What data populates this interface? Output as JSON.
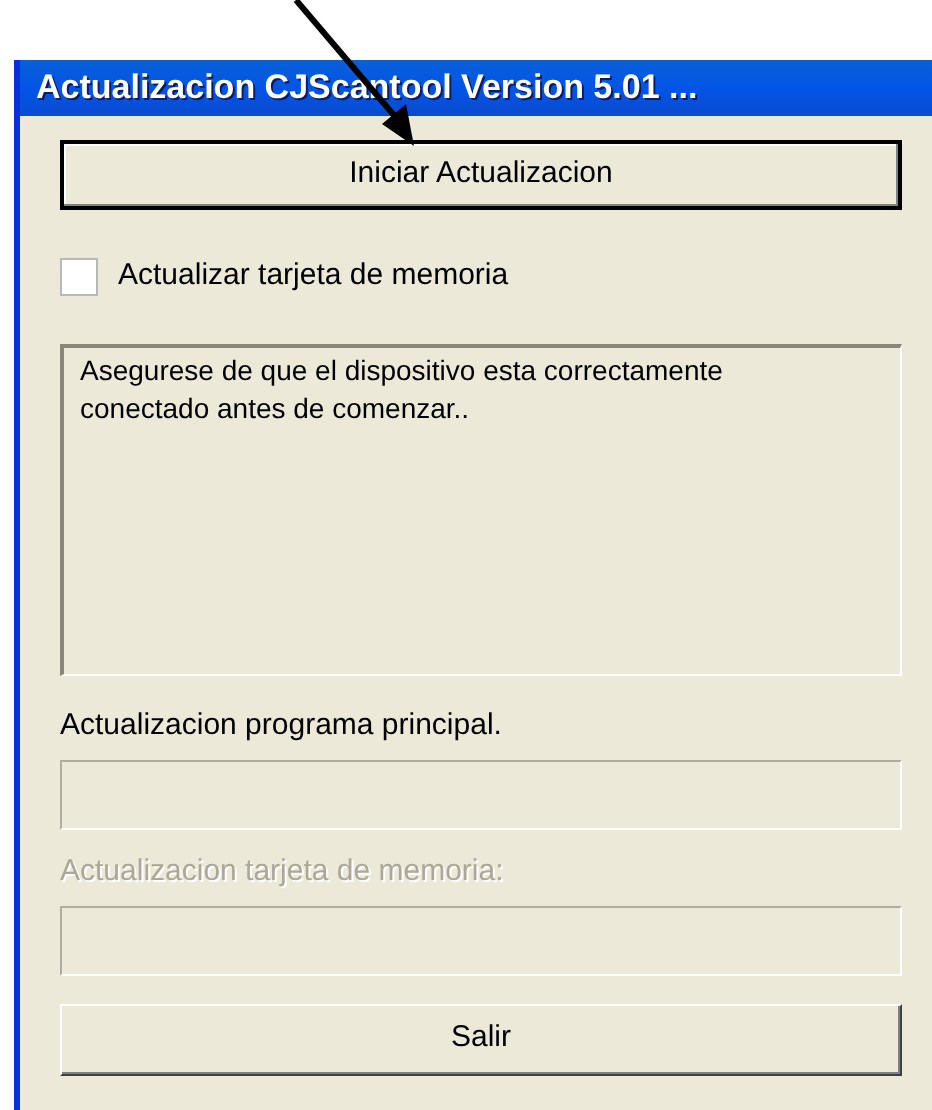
{
  "window": {
    "title": "Actualizacion CJScantool Version 5.01 ..."
  },
  "start_button": {
    "label": "Iniciar Actualizacion",
    "default": true
  },
  "checkbox": {
    "label": "Actualizar tarjeta de memoria",
    "checked": false
  },
  "message_box": {
    "text": "Asegurese de que el dispositivo esta correctamente conectado antes de comenzar.."
  },
  "progress": [
    {
      "label": "Actualizacion programa principal.",
      "disabled": false,
      "level": 0
    },
    {
      "label": "Actualizacion tarjeta de memoria:",
      "disabled": true,
      "level": 0
    }
  ],
  "exit_button": {
    "label": "Salir",
    "default": false
  }
}
